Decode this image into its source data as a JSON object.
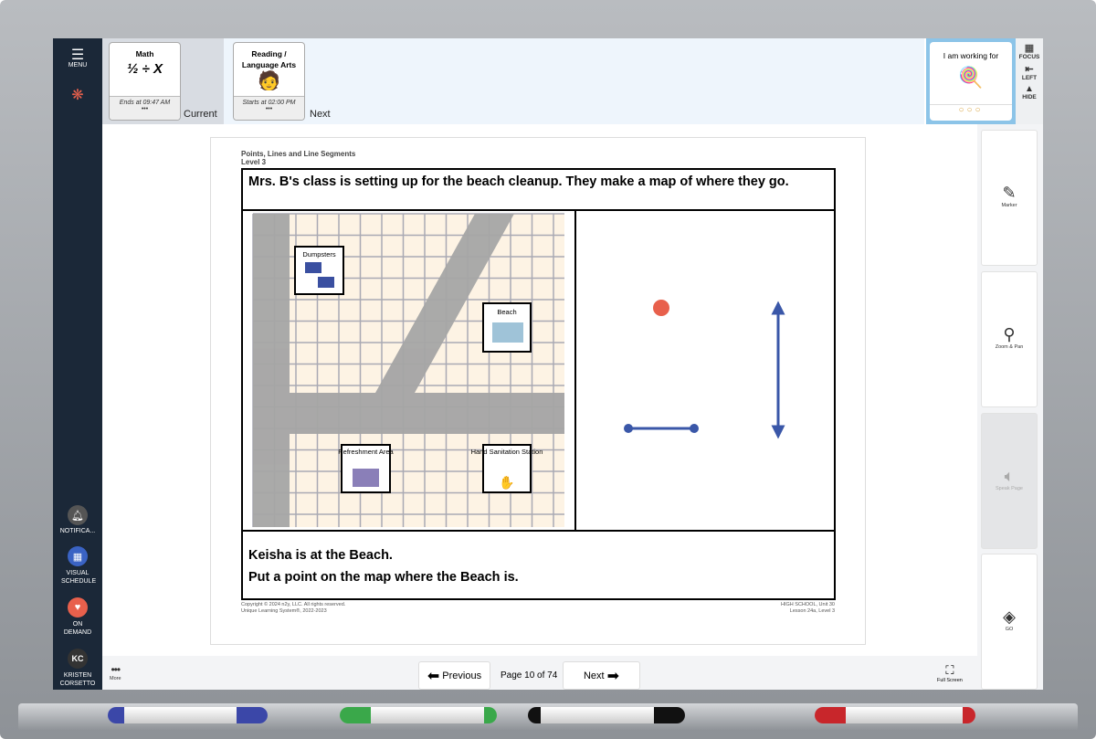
{
  "sidebar": {
    "menu": "MENU",
    "notifications": "NOTIFICA...",
    "visual_schedule": "VISUAL SCHEDULE",
    "on_demand": "ON DEMAND",
    "user_initials": "KC",
    "user_name": "KRISTEN CORSETTO",
    "more": "More"
  },
  "schedule": {
    "current": {
      "title": "Math",
      "time": "Ends at 09:47 AM",
      "dots": "•••",
      "label": "Current"
    },
    "next": {
      "title": "Reading / Language Arts",
      "time": "Starts at 02:00 PM",
      "dots": "•••",
      "label": "Next"
    }
  },
  "working_for": {
    "title": "I am working for",
    "tokens": 3,
    "tokens_earned": 0
  },
  "view_controls": {
    "focus": "FOCUS",
    "left": "LEFT",
    "hide": "HIDE"
  },
  "worksheet": {
    "title": "Points, Lines and Line Segments",
    "level": "Level 3",
    "prompt": "Mrs. B's class is setting up for the beach cleanup.  They make a map of where they go.",
    "map_labels": {
      "dumpsters": "Dumpsters",
      "beach": "Beach",
      "refreshment": "Refreshment Area",
      "sanitation": "Hand Sanitation Station"
    },
    "line1": "Keisha is at the Beach.",
    "line2": "Put a point on the map where the Beach is.",
    "copyright1": "Copyright © 2024 n2y, LLC. All rights reserved.",
    "copyright2": "Unique Learning System®, 2022-2023",
    "unit": "HIGH SCHOOL, Unit 30",
    "lesson": "Lesson 24a, Level 3"
  },
  "tools": {
    "marker": "Marker",
    "zoom": "Zoom & Pan",
    "speak": "Speak Page",
    "go": "GO"
  },
  "nav": {
    "previous": "Previous",
    "page": "Page 10 of 74",
    "next": "Next",
    "fullscreen": "Full Screen"
  },
  "colors": {
    "sidebar": "#1b2838",
    "point": "#e8604c",
    "line": "#3a57a8",
    "frame": "#9a9ea3"
  },
  "markers": [
    "blue",
    "green",
    "black",
    "red"
  ]
}
